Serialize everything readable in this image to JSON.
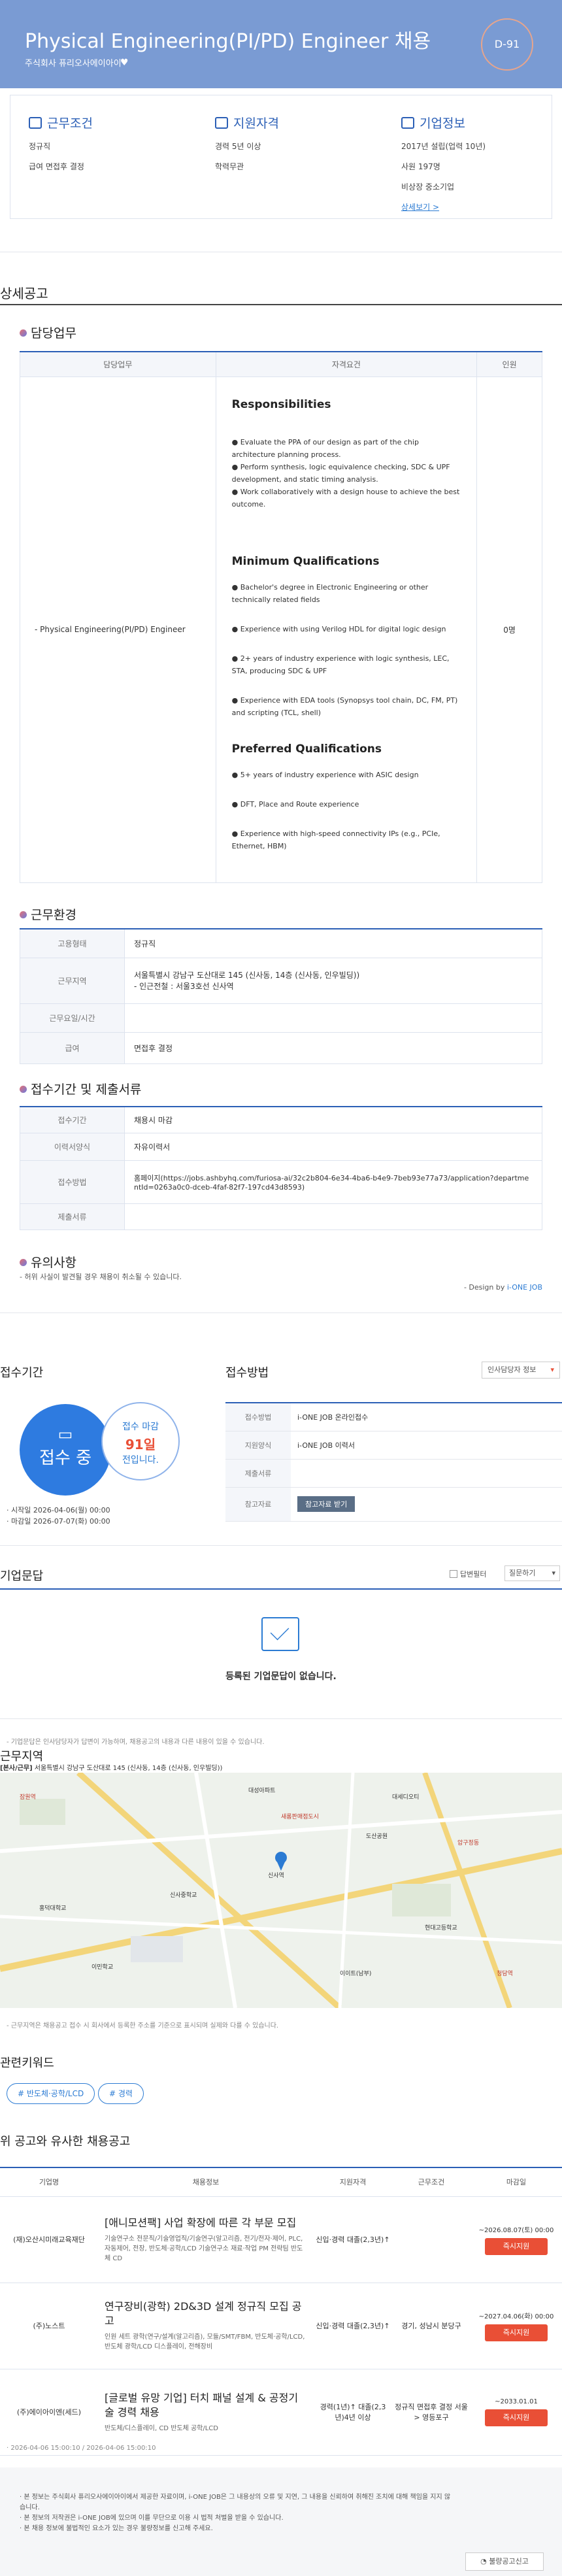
{
  "header": {
    "title": "Physical Engineering(PI/PD) Engineer 채용",
    "company": "주식회사 퓨리오사에이아이",
    "dday": "D-91"
  },
  "summary": {
    "work": {
      "title": "근무조건",
      "lines": [
        "정규직",
        "급여 면접후 결정"
      ]
    },
    "qual": {
      "title": "지원자격",
      "lines": [
        "경력 5년 이상",
        "학력무관"
      ]
    },
    "corp": {
      "title": "기업정보",
      "lines": [
        "2017년 설립(업력 10년)",
        "사원 197명",
        "비상장 중소기업"
      ],
      "link": "상세보기 >"
    }
  },
  "detail": {
    "title": "상세공고",
    "duty_title": "담당업무",
    "col_duty": "담당업무",
    "col_qual": "자격요건",
    "col_count": "인원",
    "row_duty": "- Physical Engineering(PI/PD) Engineer",
    "row_count": "0명",
    "resp_title": "Responsibilities",
    "resp": [
      "● Evaluate the PPA of our design as part of the chip architecture planning process.",
      "● Perform synthesis, logic equivalence checking, SDC & UPF development, and static timing analysis.",
      "● Work collaboratively with a design house to achieve the best outcome."
    ],
    "min_title": "Minimum Qualifications",
    "min": [
      "● Bachelor's degree in Electronic Engineering or other technically related fields",
      "● Experience with using Verilog HDL for digital logic design",
      "● 2+ years of industry experience with logic synthesis, LEC, STA, producing SDC & UPF",
      "● Experience with EDA tools (Synopsys tool chain, DC, FM, PT) and scripting (TCL, shell)"
    ],
    "pref_title": "Preferred Qualifications",
    "pref": [
      "● 5+ years of industry experience with ASIC design",
      "● DFT, Place and Route experience",
      "● Experience with high-speed connectivity IPs (e.g., PCIe, Ethernet, HBM)"
    ]
  },
  "env": {
    "title": "근무환경",
    "rows": [
      {
        "k": "고용형태",
        "v": "정규직"
      },
      {
        "k": "근무지역",
        "v": "서울특별시 강남구 도산대로 145 (신사동, 14층 (신사동, 인우빌딩))",
        "v2": "- 인근전철 : 서울3호선 신사역"
      },
      {
        "k": "근무요일/시간",
        "v": ""
      },
      {
        "k": "급여",
        "v": "면접후 결정"
      }
    ]
  },
  "recv": {
    "title": "접수기간 및 제출서류",
    "rows": [
      {
        "k": "접수기간",
        "v": "채용시 마감"
      },
      {
        "k": "이력서양식",
        "v": "자유이력서"
      },
      {
        "k": "접수방법",
        "v": "홈페이지(https://jobs.ashbyhq.com/furiosa-ai/32c2b804-6e34-4ba6-b4e9-7beb93e77a73/application?departmentId=0263a0c0-dceb-4faf-82f7-197cd43d8593)"
      },
      {
        "k": "제출서류",
        "v": ""
      }
    ]
  },
  "notice": {
    "title": "유의사항",
    "text": "- 허위 사실이 발견될 경우 채용이 취소될 수 있습니다.",
    "design_prefix": "- Design by ",
    "design_link": "i-ONE JOB"
  },
  "period": {
    "title": "접수기간",
    "status": "접수 중",
    "deadline_label": "접수 마감",
    "deadline_days": "91일",
    "deadline_suffix": "전입니다.",
    "start": "· 시작일 2026-04-06(월) 00:00",
    "end": "· 마감일 2026-07-07(화) 00:00"
  },
  "apply": {
    "title": "접수방법",
    "manager_btn": "인사담당자 정보",
    "rows": [
      {
        "k": "접수방법",
        "v": "i-ONE JOB 온라인접수"
      },
      {
        "k": "지원양식",
        "v": "i-ONE JOB 이력서"
      },
      {
        "k": "제출서류",
        "v": ""
      },
      {
        "k": "참고자료",
        "v": "참고자료 받기"
      }
    ]
  },
  "qa": {
    "title": "기업문답",
    "checkbox": "답변필터",
    "sort": "질문하기",
    "empty": "등록된 기업문답이 없습니다.",
    "note": "- 기업문답은 인사담당자가 답변이 가능하며, 채용공고의 내용과 다른 내용이 있을 수 있습니다."
  },
  "location": {
    "title": "근무지역",
    "addr_label": "[본사/근무]",
    "addr": "서울특별시 강남구 도산대로 145 (신사동, 14층 (신사동, 인우빌딩))",
    "note": "- 근무지역은 채용공고 접수 시 회사에서 등록한 주소를 기준으로 표시되며 실제와 다를 수 있습니다.",
    "map_labels": [
      "신사역",
      "대성아파트",
      "잠원역",
      "새롬판매점도시",
      "대세디오티",
      "신사중학교",
      "압구정동",
      "홍덕대학교",
      "현대고등학교",
      "이민학교",
      "이이트(남부)",
      "청담역",
      "도산공원"
    ]
  },
  "keywords": {
    "title": "관련키워드",
    "items": [
      "# 반도체·공학/LCD",
      "# 경력"
    ]
  },
  "similar": {
    "title": "위 공고와 유사한 채용공고",
    "cols": [
      "기업명",
      "채용정보",
      "지원자격",
      "근무조건",
      "마감일"
    ],
    "rows": [
      {
        "company": "(재)오산시미래교육재단",
        "title": "[애니모션팩] 사업 확장에 따른 각 부문 모집",
        "desc": "기술연구소 전문직/기술영업직/기술연구(알고리즘, 전기/전자·제어, PLC, 자동제어, 전장, 반도체·공학/LCD 기술연구소 재료·작업 PM 전략팀 반도체 CD",
        "qual": "신입·경력 대졸(2,3년)↑",
        "cond": "",
        "deadline": "~2026.08.07(토) 00:00",
        "btn": "즉시지원"
      },
      {
        "company": "(주)노스트",
        "title": "연구장비(광학) 2D&3D 설계 정규직 모집 공고",
        "desc": "인원 세트 광학(연구/설계(알고리즘), 모듈/SMT/FBM, 반도체·공학/LCD, 반도체 광학/LCD 디스플레이, 전해장비",
        "qual": "신입·경력 대졸(2,3년)↑",
        "cond": "경기, 성남시 분당구",
        "deadline": "~2027.04.06(화) 00:00",
        "btn": "즉시지원"
      },
      {
        "company": "(주)에이아이엔(세드)",
        "title": "[글로벌 유망 기업] 터치 패널 설계 & 공정기술 경력 채용",
        "desc": "반도체/디스플레이, CD 반도체 공학/LCD",
        "qual": "경력(1년)↑ 대졸(2,3년)4년 이상",
        "cond": "정규직 면접후 결정 서울 > 영등포구",
        "deadline": "~2033.01.01",
        "btn": "즉시지원"
      }
    ]
  },
  "dates": {
    "text": "· 2026-04-06 15:00:10 / 2026-04-06 15:00:10"
  },
  "footer": {
    "lines": [
      "· 본 정보는 주식회사 퓨리오사에이아이에서 제공한 자료이며, i-ONE JOB은 그 내용상의 오류 및 지연, 그 내용을 신뢰하여 취해진 조치에 대해 책임을 지지 않습니다.",
      "· 본 정보의 저작권은 i-ONE JOB에 있으며 이를 무단으로 이용 시 법적 처벌을 받을 수 있습니다.",
      "· 본 채용 정보에 불법적인 요소가 있는 경우 불량정보를 신고해 주세요."
    ],
    "report_btn": "불량공고신고"
  },
  "colors": {
    "primary": "#2b5fb6",
    "header_bg": "#7a9bd3",
    "circle": "#2e7be0",
    "btn_red": "#e94f36"
  },
  "icons": [
    "heart-icon",
    "clipboard-icon",
    "monitor-icon",
    "building-icon",
    "envelope-icon",
    "map-pin-icon"
  ]
}
